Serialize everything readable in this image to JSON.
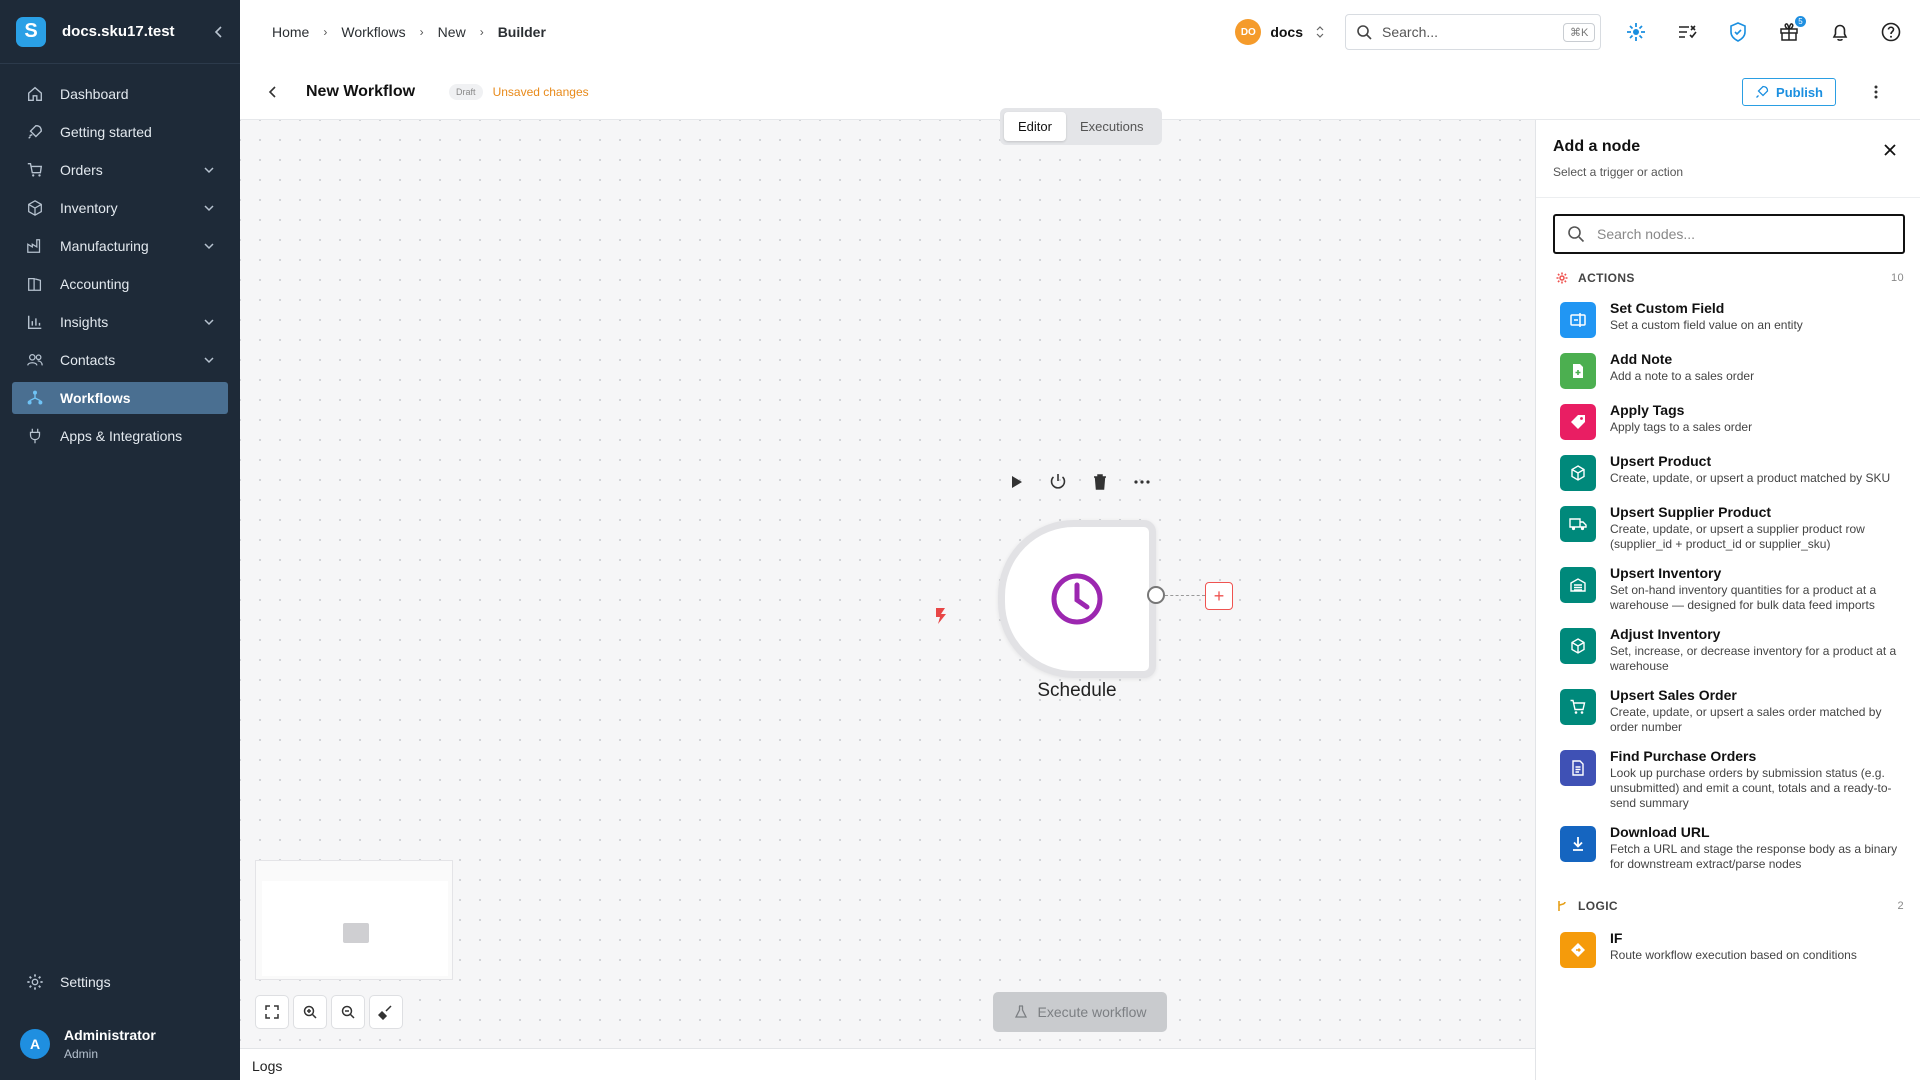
{
  "sidebar": {
    "brand": {
      "logo_letter": "S",
      "name": "docs.sku17.test"
    },
    "items": [
      {
        "label": "Dashboard",
        "icon": "home-icon",
        "expandable": false
      },
      {
        "label": "Getting started",
        "icon": "rocket-icon",
        "expandable": false
      },
      {
        "label": "Orders",
        "icon": "cart-icon",
        "expandable": true
      },
      {
        "label": "Inventory",
        "icon": "cube-icon",
        "expandable": true
      },
      {
        "label": "Manufacturing",
        "icon": "factory-icon",
        "expandable": true
      },
      {
        "label": "Accounting",
        "icon": "book-icon",
        "expandable": false
      },
      {
        "label": "Insights",
        "icon": "bar-chart-icon",
        "expandable": true
      },
      {
        "label": "Contacts",
        "icon": "users-icon",
        "expandable": true
      },
      {
        "label": "Workflows",
        "icon": "workflow-icon",
        "expandable": false,
        "active": true
      },
      {
        "label": "Apps & Integrations",
        "icon": "plug-icon",
        "expandable": false
      }
    ],
    "settings_label": "Settings",
    "user": {
      "initial": "A",
      "name": "Administrator",
      "role": "Admin"
    }
  },
  "topbar": {
    "breadcrumbs": [
      "Home",
      "Workflows",
      "New",
      "Builder"
    ],
    "org": {
      "badge": "DO",
      "name": "docs"
    },
    "search": {
      "placeholder": "Search...",
      "shortcut": "⌘K"
    },
    "gift_badge": "5",
    "accent": "#1b8fe0"
  },
  "workflow": {
    "title": "New Workflow",
    "status": "Draft",
    "unsaved": "Unsaved changes",
    "publish_label": "Publish"
  },
  "canvas": {
    "tabs": [
      "Editor",
      "Executions"
    ],
    "active_tab": "Editor",
    "node": {
      "label": "Schedule",
      "icon": "clock-icon",
      "color": "#9c27b0"
    },
    "execute_label": "Execute workflow",
    "logs_label": "Logs"
  },
  "panel": {
    "title": "Add a node",
    "subtitle": "Select a trigger or action",
    "search_placeholder": "Search nodes...",
    "sections": [
      {
        "name": "ACTIONS",
        "count": "10",
        "items": [
          {
            "name": "Set Custom Field",
            "desc": "Set a custom field value on an entity",
            "color": "#2196f3",
            "icon": "custom-field-icon"
          },
          {
            "name": "Add Note",
            "desc": "Add a note to a sales order",
            "color": "#4caf50",
            "icon": "note-add-icon"
          },
          {
            "name": "Apply Tags",
            "desc": "Apply tags to a sales order",
            "color": "#e91e63",
            "icon": "tag-icon"
          },
          {
            "name": "Upsert Product",
            "desc": "Create, update, or upsert a product matched by SKU",
            "color": "#00897b",
            "icon": "cube-icon"
          },
          {
            "name": "Upsert Supplier Product",
            "desc": "Create, update, or upsert a supplier product row (supplier_id + product_id or supplier_sku)",
            "color": "#00897b",
            "icon": "truck-icon"
          },
          {
            "name": "Upsert Inventory",
            "desc": "Set on-hand inventory quantities for a product at a warehouse — designed for bulk data feed imports",
            "color": "#00897b",
            "icon": "warehouse-icon"
          },
          {
            "name": "Adjust Inventory",
            "desc": "Set, increase, or decrease inventory for a product at a warehouse",
            "color": "#00897b",
            "icon": "cube-icon"
          },
          {
            "name": "Upsert Sales Order",
            "desc": "Create, update, or upsert a sales order matched by order number",
            "color": "#00897b",
            "icon": "cart-icon"
          },
          {
            "name": "Find Purchase Orders",
            "desc": "Look up purchase orders by submission status (e.g. unsubmitted) and emit a count, totals and a ready-to-send summary",
            "color": "#3f51b5",
            "icon": "document-icon"
          },
          {
            "name": "Download URL",
            "desc": "Fetch a URL and stage the response body as a binary for downstream extract/parse nodes",
            "color": "#1565c0",
            "icon": "download-icon"
          }
        ]
      },
      {
        "name": "LOGIC",
        "count": "2",
        "items": [
          {
            "name": "IF",
            "desc": "Route workflow execution based on conditions",
            "color": "#f59b0b",
            "icon": "diamond-icon"
          }
        ]
      }
    ]
  }
}
